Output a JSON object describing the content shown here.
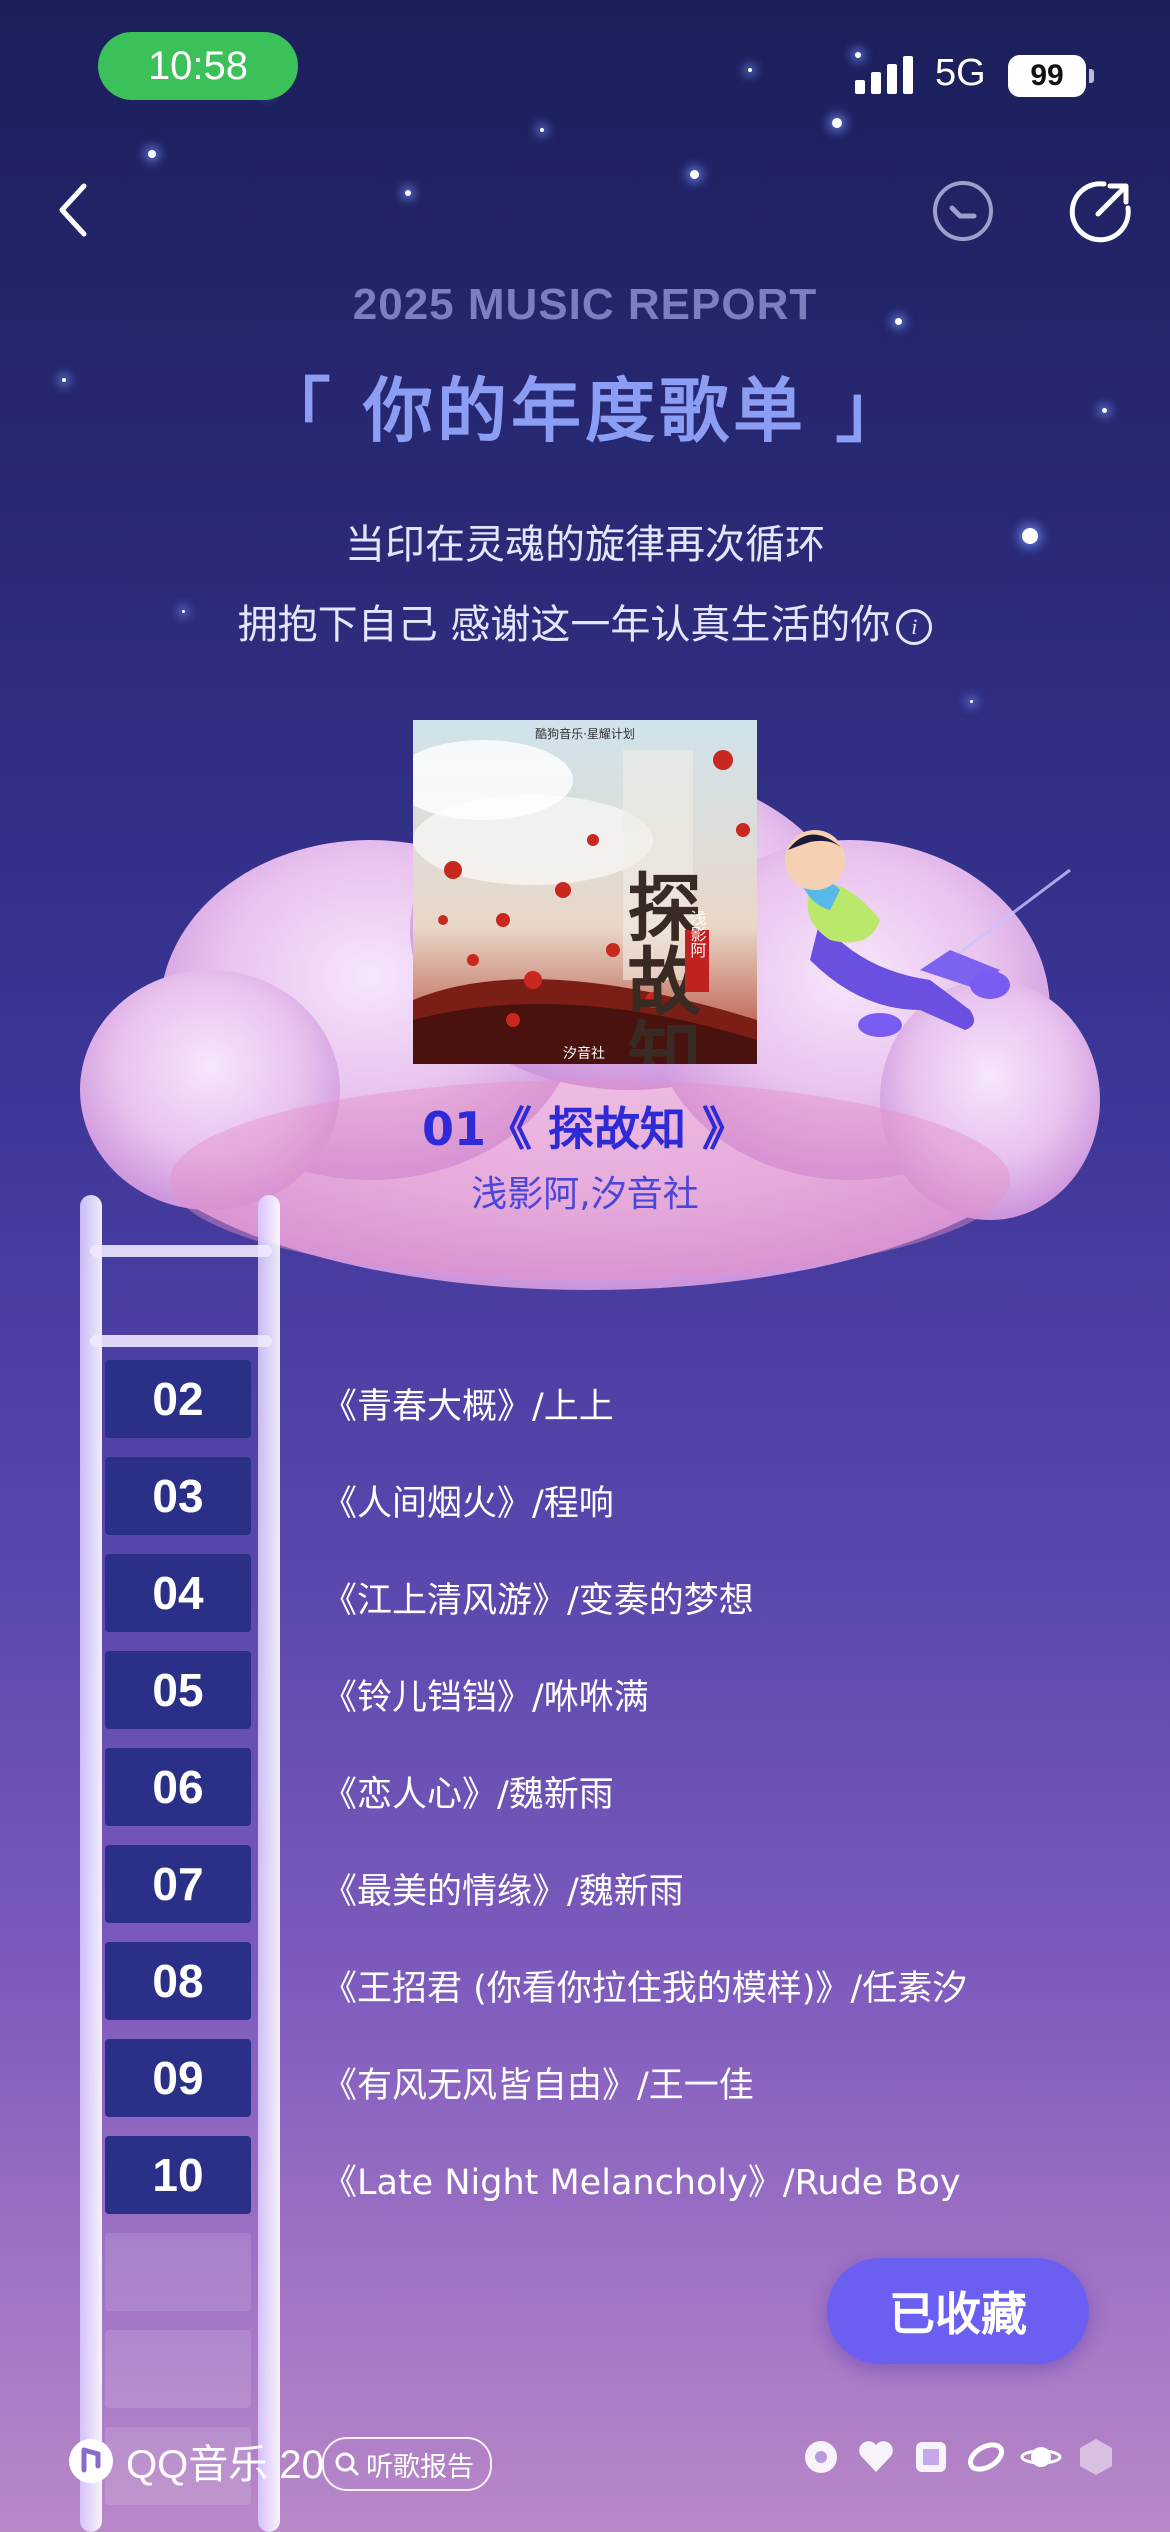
{
  "status_bar": {
    "time": "10:58",
    "network": "5G",
    "battery": "99"
  },
  "header": {
    "eyebrow": "2025 MUSIC REPORT",
    "title": "「 你的年度歌单 」",
    "subtitle_line1": "当印在灵魂的旋律再次循环",
    "subtitle_line2": "拥抱下自己 感谢这一年认真生活的你",
    "info_glyph": "i"
  },
  "top_track": {
    "rank_title": "01《 探故知 》",
    "artist": "浅影阿,汐音社",
    "cover": {
      "top_caption": "酷狗音乐·星耀计划",
      "title": "探故知",
      "stamp": "浅影阿",
      "label": "汐音社"
    }
  },
  "tracks": [
    {
      "rank": "02",
      "text": "《青春大概》/上上"
    },
    {
      "rank": "03",
      "text": "《人间烟火》/程响"
    },
    {
      "rank": "04",
      "text": "《江上清风游》/变奏的梦想"
    },
    {
      "rank": "05",
      "text": "《铃儿铛铛》/咻咻满"
    },
    {
      "rank": "06",
      "text": "《恋人心》/魏新雨"
    },
    {
      "rank": "07",
      "text": "《最美的情缘》/魏新雨"
    },
    {
      "rank": "08",
      "text": "《王招君 (你看你拉住我的模样)》/任素汐"
    },
    {
      "rank": "09",
      "text": "《有风无风皆自由》/王一佳"
    },
    {
      "rank": "10",
      "text": "《Late Night Melancholy》/Rude Boy"
    }
  ],
  "collect_button": "已收藏",
  "footer": {
    "brand": "QQ音乐 20",
    "report_chip": "听歌报告"
  },
  "colors": {
    "accent": "#6a5ff0",
    "top_track_title": "#2d2ad6",
    "status_pill": "#3cc05a"
  }
}
